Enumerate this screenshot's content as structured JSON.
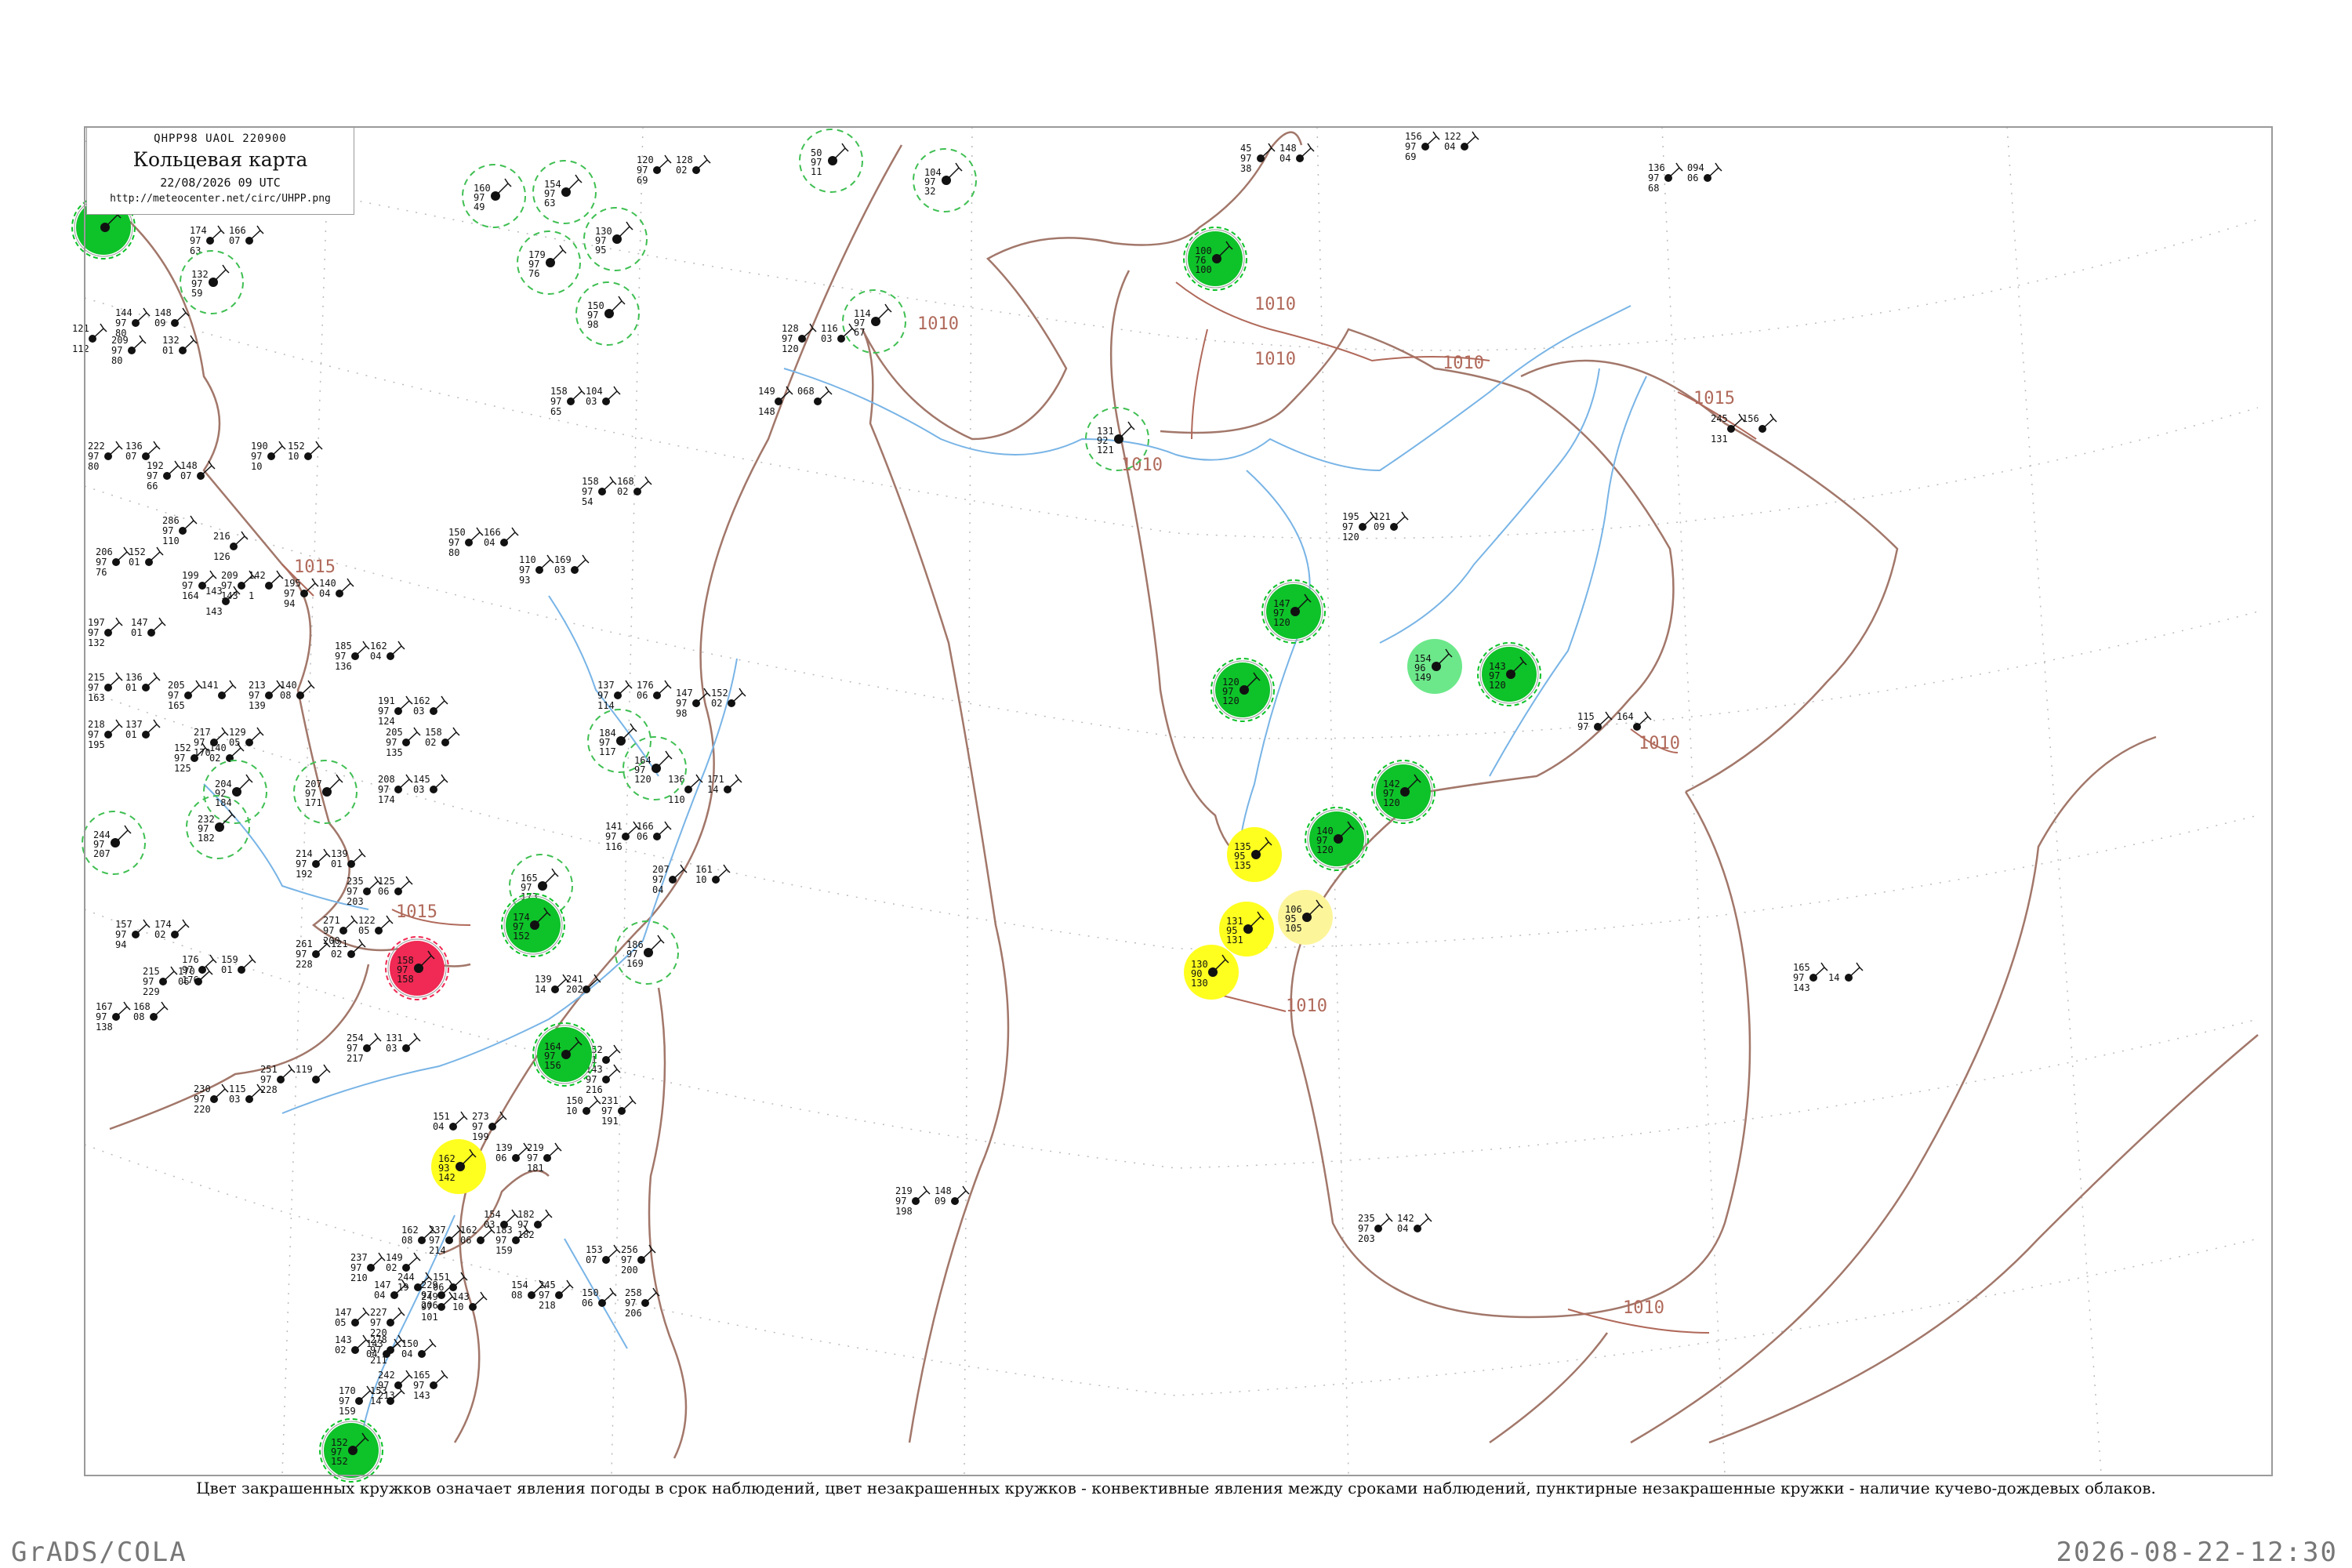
{
  "title_box": {
    "code_line": "QHPP98  UAOL  220900",
    "title": "Кольцевая карта",
    "time": "22/08/2026 09 UTC",
    "url": "http://meteocenter.net/circ/UHPP.png"
  },
  "footer": {
    "caption": "Цвет закрашенных кружков означает явления погоды в срок наблюдений, цвет незакрашенных кружков - конвективные явления между сроками наблюдений, пунктирные незакрашенные кружки - наличие кучево-дождевых облаков.",
    "left": "GrADS/COLA",
    "right": "2026-08-22-12:30"
  },
  "colors": {
    "green": "#0ec229",
    "light_green": "#6ce88a",
    "yellow": "#ffff1f",
    "pale_yellow": "#fdf59a",
    "red": "#f02a54",
    "isobar": "#b0695a",
    "river": "#78b4e6",
    "grid": "#bbbbbb",
    "dashed_ring": "#3fbf52"
  },
  "isobar_labels": [
    "1010",
    "1010",
    "1010",
    "1010",
    "1015",
    "1010",
    "1015",
    "1015",
    "1010",
    "1010",
    "1010"
  ],
  "stations": [
    {
      "name": "",
      "nums": [
        "",
        "",
        ""
      ],
      "fill": "green",
      "ring": "double"
    },
    {
      "name": "",
      "nums": [
        "132",
        "97",
        "59"
      ],
      "fill": "none",
      "ring": "dashed"
    },
    {
      "name": "",
      "nums": [
        "160",
        "97",
        "49"
      ],
      "fill": "none",
      "ring": "dashed"
    },
    {
      "name": "",
      "nums": [
        "154",
        "97",
        "63"
      ],
      "fill": "none",
      "ring": "dashed"
    },
    {
      "name": "",
      "nums": [
        "179",
        "97",
        "76"
      ],
      "fill": "none",
      "ring": "dashed"
    },
    {
      "name": "",
      "nums": [
        "130",
        "97",
        "95"
      ],
      "fill": "none",
      "ring": "dashed"
    },
    {
      "name": "",
      "nums": [
        "150",
        "97",
        "98"
      ],
      "fill": "none",
      "ring": "dashed"
    },
    {
      "name": "",
      "nums": [
        "50",
        "97",
        "11"
      ],
      "fill": "none",
      "ring": "dashed"
    },
    {
      "name": "",
      "nums": [
        "104",
        "97",
        "32"
      ],
      "fill": "none",
      "ring": "dashed"
    },
    {
      "name": "",
      "nums": [
        "114",
        "97",
        "67"
      ],
      "fill": "none",
      "ring": "dashed"
    },
    {
      "name": "",
      "nums": [
        "100",
        "76",
        "100"
      ],
      "fill": "green",
      "ring": "double"
    },
    {
      "name": "",
      "nums": [
        "131",
        "92",
        "121"
      ],
      "fill": "none",
      "ring": "dashed"
    },
    {
      "name": "",
      "nums": [
        "147",
        "97",
        "120"
      ],
      "fill": "green",
      "ring": "double"
    },
    {
      "name": "",
      "nums": [
        "120",
        "97",
        "120"
      ],
      "fill": "green",
      "ring": "double"
    },
    {
      "name": "",
      "nums": [
        "154",
        "96",
        "149"
      ],
      "fill": "light_green",
      "ring": "none"
    },
    {
      "name": "",
      "nums": [
        "143",
        "97",
        "120"
      ],
      "fill": "green",
      "ring": "double"
    },
    {
      "name": "",
      "nums": [
        "142",
        "97",
        "120"
      ],
      "fill": "green",
      "ring": "double"
    },
    {
      "name": "",
      "nums": [
        "140",
        "97",
        "120"
      ],
      "fill": "green",
      "ring": "double"
    },
    {
      "name": "",
      "nums": [
        "135",
        "95",
        "135"
      ],
      "fill": "yellow",
      "ring": "none"
    },
    {
      "name": "",
      "nums": [
        "131",
        "95",
        "131"
      ],
      "fill": "yellow",
      "ring": "none"
    },
    {
      "name": "",
      "nums": [
        "130",
        "90",
        "130"
      ],
      "fill": "yellow",
      "ring": "none"
    },
    {
      "name": "",
      "nums": [
        "106",
        "95",
        "105"
      ],
      "fill": "pale_yellow",
      "ring": "none"
    },
    {
      "name": "",
      "nums": [
        "184",
        "97",
        "117"
      ],
      "fill": "none",
      "ring": "dashed"
    },
    {
      "name": "",
      "nums": [
        "164",
        "97",
        "120"
      ],
      "fill": "none",
      "ring": "dashed"
    },
    {
      "name": "",
      "nums": [
        "207",
        "97",
        "171"
      ],
      "fill": "none",
      "ring": "dashed"
    },
    {
      "name": "",
      "nums": [
        "204",
        "92",
        "184"
      ],
      "fill": "none",
      "ring": "dashed"
    },
    {
      "name": "",
      "nums": [
        "232",
        "97",
        "182"
      ],
      "fill": "none",
      "ring": "dashed"
    },
    {
      "name": "",
      "nums": [
        "244",
        "97",
        "207"
      ],
      "fill": "none",
      "ring": "dashed"
    },
    {
      "name": "",
      "nums": [
        "165",
        "97",
        "173"
      ],
      "fill": "none",
      "ring": "dashed"
    },
    {
      "name": "",
      "nums": [
        "174",
        "97",
        "152"
      ],
      "fill": "green",
      "ring": "double"
    },
    {
      "name": "",
      "nums": [
        "186",
        "97",
        "169"
      ],
      "fill": "none",
      "ring": "dashed"
    },
    {
      "name": "",
      "nums": [
        "158",
        "97",
        "158"
      ],
      "fill": "red",
      "ring": "double"
    },
    {
      "name": "",
      "nums": [
        "164",
        "97",
        "156"
      ],
      "fill": "green",
      "ring": "double"
    },
    {
      "name": "",
      "nums": [
        "162",
        "93",
        "142"
      ],
      "fill": "yellow",
      "ring": "none"
    },
    {
      "name": "",
      "nums": [
        "152",
        "97",
        "152"
      ],
      "fill": "green",
      "ring": "double"
    }
  ],
  "plain_stations": [
    [
      "174",
      "97",
      "63"
    ],
    [
      "166",
      "07",
      ""
    ],
    [
      "144",
      "97",
      "80"
    ],
    [
      "148",
      "09",
      ""
    ],
    [
      "121",
      "",
      "112"
    ],
    [
      "209",
      "97",
      "80"
    ],
    [
      "132",
      "01",
      ""
    ],
    [
      "222",
      "97",
      "80"
    ],
    [
      "136",
      "07",
      ""
    ],
    [
      "192",
      "97",
      "66"
    ],
    [
      "148",
      "07",
      ""
    ],
    [
      "190",
      "97",
      "10"
    ],
    [
      "152",
      "10",
      ""
    ],
    [
      "286",
      "97",
      "110"
    ],
    [
      "216",
      "",
      "126"
    ],
    [
      "206",
      "97",
      "76"
    ],
    [
      "152",
      "01",
      ""
    ],
    [
      "199",
      "97",
      "164"
    ],
    [
      "143",
      "",
      "143"
    ],
    [
      "209",
      "97",
      "143"
    ],
    [
      "142",
      "",
      "1"
    ],
    [
      "195",
      "97",
      "94"
    ],
    [
      "140",
      "04",
      ""
    ],
    [
      "197",
      "97",
      "132"
    ],
    [
      "147",
      "01",
      ""
    ],
    [
      "215",
      "97",
      "163"
    ],
    [
      "136",
      "01",
      ""
    ],
    [
      "218",
      "97",
      "195"
    ],
    [
      "137",
      "01",
      ""
    ],
    [
      "205",
      "97",
      "165"
    ],
    [
      "141",
      "",
      ""
    ],
    [
      "213",
      "97",
      "139"
    ],
    [
      "140",
      "08",
      ""
    ],
    [
      "217",
      "97",
      "170"
    ],
    [
      "129",
      "05",
      ""
    ],
    [
      "152",
      "97",
      "125"
    ],
    [
      "140",
      "02",
      ""
    ],
    [
      "185",
      "97",
      "136"
    ],
    [
      "162",
      "04",
      ""
    ],
    [
      "191",
      "97",
      "124"
    ],
    [
      "162",
      "03",
      ""
    ],
    [
      "205",
      "97",
      "135"
    ],
    [
      "158",
      "02",
      ""
    ],
    [
      "208",
      "97",
      "174"
    ],
    [
      "145",
      "03",
      ""
    ],
    [
      "214",
      "97",
      "192"
    ],
    [
      "139",
      "01",
      ""
    ],
    [
      "235",
      "97",
      "203"
    ],
    [
      "125",
      "06",
      ""
    ],
    [
      "271",
      "97",
      "200"
    ],
    [
      "122",
      "05",
      ""
    ],
    [
      "261",
      "97",
      "228"
    ],
    [
      "121",
      "02",
      ""
    ],
    [
      "176",
      "97",
      "176"
    ],
    [
      "159",
      "01",
      ""
    ],
    [
      "215",
      "97",
      "229"
    ],
    [
      "170",
      "06",
      ""
    ],
    [
      "254",
      "97",
      "217"
    ],
    [
      "131",
      "03",
      ""
    ],
    [
      "251",
      "97",
      "228"
    ],
    [
      "119",
      "",
      ""
    ],
    [
      "230",
      "97",
      "220"
    ],
    [
      "115",
      "03",
      ""
    ],
    [
      "157",
      "97",
      "94"
    ],
    [
      "174",
      "02",
      ""
    ],
    [
      "167",
      "97",
      "138"
    ],
    [
      "168",
      "08",
      ""
    ],
    [
      "137",
      "97",
      "114"
    ],
    [
      "176",
      "06",
      ""
    ],
    [
      "141",
      "97",
      "116"
    ],
    [
      "166",
      "06",
      ""
    ],
    [
      "136",
      "",
      "110"
    ],
    [
      "171",
      "14",
      ""
    ],
    [
      "147",
      "97",
      "98"
    ],
    [
      "152",
      "02",
      ""
    ],
    [
      "207",
      "97",
      "04"
    ],
    [
      "161",
      "10",
      ""
    ],
    [
      "158",
      "97",
      "54"
    ],
    [
      "168",
      "02",
      ""
    ],
    [
      "150",
      "97",
      "80"
    ],
    [
      "166",
      "04",
      ""
    ],
    [
      "110",
      "97",
      "93"
    ],
    [
      "169",
      "03",
      ""
    ],
    [
      "158",
      "97",
      "65"
    ],
    [
      "104",
      "03",
      ""
    ],
    [
      "120",
      "97",
      "69"
    ],
    [
      "128",
      "02",
      ""
    ],
    [
      "45",
      "97",
      "38"
    ],
    [
      "148",
      "04",
      ""
    ],
    [
      "156",
      "97",
      "69"
    ],
    [
      "122",
      "04",
      ""
    ],
    [
      "136",
      "97",
      "68"
    ],
    [
      "094",
      "06",
      ""
    ],
    [
      "149",
      "",
      "148"
    ],
    [
      "068",
      "",
      ""
    ],
    [
      "128",
      "97",
      "120"
    ],
    [
      "116",
      "03",
      ""
    ],
    [
      "195",
      "97",
      "120"
    ],
    [
      "121",
      "09",
      ""
    ],
    [
      "115",
      "97",
      ""
    ],
    [
      "164",
      "",
      ""
    ],
    [
      "165",
      "97",
      "143"
    ],
    [
      "",
      "14",
      ""
    ],
    [
      "245",
      "",
      "131"
    ],
    [
      "156",
      "",
      ""
    ],
    [
      "219",
      "97",
      "198"
    ],
    [
      "148",
      "09",
      ""
    ],
    [
      "235",
      "97",
      "203"
    ],
    [
      "142",
      "04",
      ""
    ],
    [
      "139",
      "14",
      ""
    ],
    [
      "241",
      "202",
      ""
    ],
    [
      "150",
      "10",
      ""
    ],
    [
      "231",
      "97",
      "191"
    ],
    [
      "152",
      "11",
      ""
    ],
    [
      "143",
      "97",
      "216"
    ],
    [
      "151",
      "04",
      ""
    ],
    [
      "273",
      "97",
      "199"
    ],
    [
      "139",
      "06",
      ""
    ],
    [
      "219",
      "97",
      "181"
    ],
    [
      "154",
      "03",
      ""
    ],
    [
      "182",
      "97",
      "182"
    ],
    [
      "162",
      "06",
      ""
    ],
    [
      "183",
      "97",
      "159"
    ],
    [
      "162",
      "08",
      ""
    ],
    [
      "237",
      "97",
      "214"
    ],
    [
      "244",
      "19",
      ""
    ],
    [
      "151",
      "06",
      ""
    ],
    [
      "237",
      "97",
      "210"
    ],
    [
      "149",
      "02",
      ""
    ],
    [
      "153",
      "07",
      ""
    ],
    [
      "256",
      "97",
      "200"
    ],
    [
      "150",
      "06",
      ""
    ],
    [
      "258",
      "97",
      "206"
    ],
    [
      "147",
      "04",
      ""
    ],
    [
      "229",
      "97",
      "206"
    ],
    [
      "249",
      "97",
      "101"
    ],
    [
      "143",
      "10",
      ""
    ],
    [
      "154",
      "08",
      ""
    ],
    [
      "245",
      "97",
      "218"
    ],
    [
      "147",
      "05",
      ""
    ],
    [
      "227",
      "97",
      "220"
    ],
    [
      "143",
      "02",
      ""
    ],
    [
      "278",
      "97",
      "211"
    ],
    [
      "143",
      "04",
      ""
    ],
    [
      "150",
      "04",
      ""
    ],
    [
      "242",
      "97",
      "213"
    ],
    [
      "165",
      "97",
      "143"
    ],
    [
      "170",
      "97",
      "159"
    ],
    [
      "153",
      "14",
      ""
    ]
  ]
}
